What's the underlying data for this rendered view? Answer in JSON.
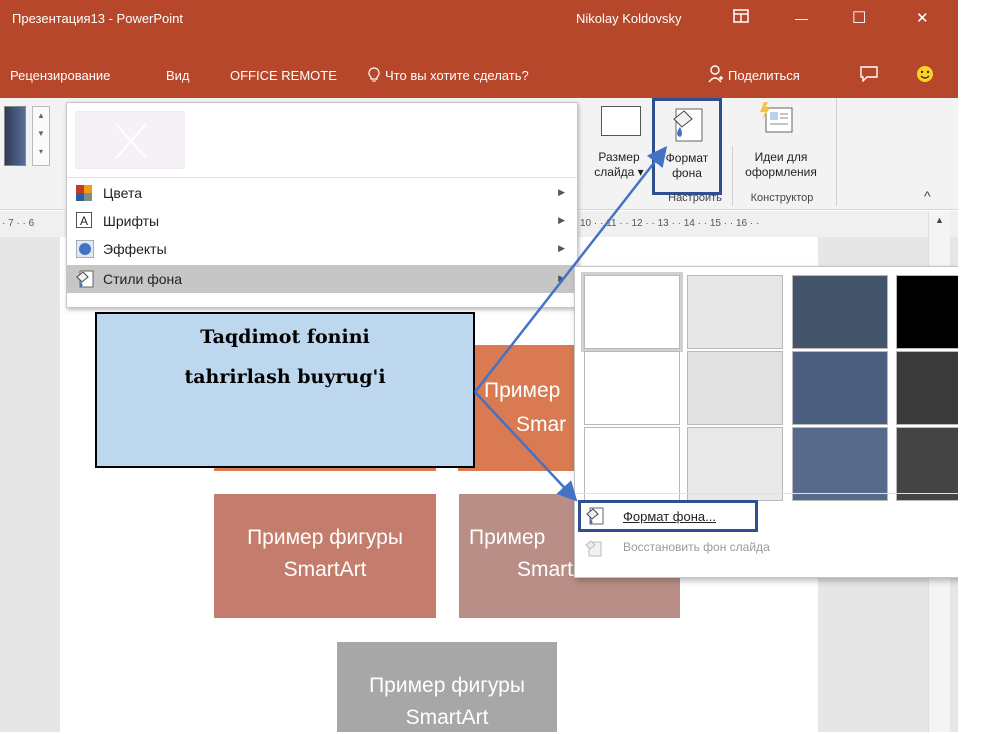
{
  "titlebar": {
    "doc_title": "Презентация13 - PowerPoint",
    "user": "Nikolay Koldovsky",
    "ribbon_display_icon": "ribbon-display-icon",
    "minimize": "—",
    "maximize": "☐",
    "close": "✕"
  },
  "tabs": {
    "review": "Рецензирование",
    "view": "Вид",
    "office_remote": "OFFICE REMOTE",
    "tell_me": "Что вы хотите сделать?",
    "share": "Поделиться"
  },
  "ribbon": {
    "slide_size_line1": "Размер",
    "slide_size_line2": "слайда ▾",
    "format_bg_line1": "Формат",
    "format_bg_line2": "фона",
    "design_ideas_line1": "Идеи для",
    "design_ideas_line2": "оформления",
    "group_customize": "Настроить",
    "group_designer": "Конструктор",
    "collapse": "^"
  },
  "ruler": {
    "left_ticks": "· 7 · · 6",
    "right_ticks": "10 · · 11 · · 12 · · 13 · · 14 · · 15 · · 16 · ·"
  },
  "variants_menu": {
    "items": [
      {
        "label": "Цвета",
        "icon": "colors-icon"
      },
      {
        "label": "Шрифты",
        "icon": "fonts-icon"
      },
      {
        "label": "Эффекты",
        "icon": "effects-icon"
      },
      {
        "label": "Стили фона",
        "icon": "background-styles-icon"
      }
    ]
  },
  "gallery": {
    "swatch_colors": [
      "#ffffff",
      "#e7e7e7",
      "#44546a",
      "#000000",
      "#ffffff",
      "#e2e2e2",
      "#4c5f80",
      "#3a3a3a",
      "#ffffff",
      "#e9e9e9",
      "#586a8a",
      "#444444"
    ],
    "format_background": "Формат фона...",
    "reset_background": "Восстановить фон слайда"
  },
  "note": {
    "line1": "Taqdimot fonini",
    "line2": "tahrirlash buyrug'i"
  },
  "slide": {
    "shape_text_a": "Пример",
    "shape_text_b": "Smar",
    "shape1_line1": "Пример фигуры",
    "shape1_line2": "SmartArt",
    "shape2_line1": "Пример",
    "shape2_line2": "SmartArt",
    "shape3_line1": "Пример фигуры",
    "shape3_line2": "SmartArt"
  },
  "colors": {
    "accent": "#b7472a",
    "highlight_border": "#2f4f8f",
    "arrow": "#4472c4"
  }
}
